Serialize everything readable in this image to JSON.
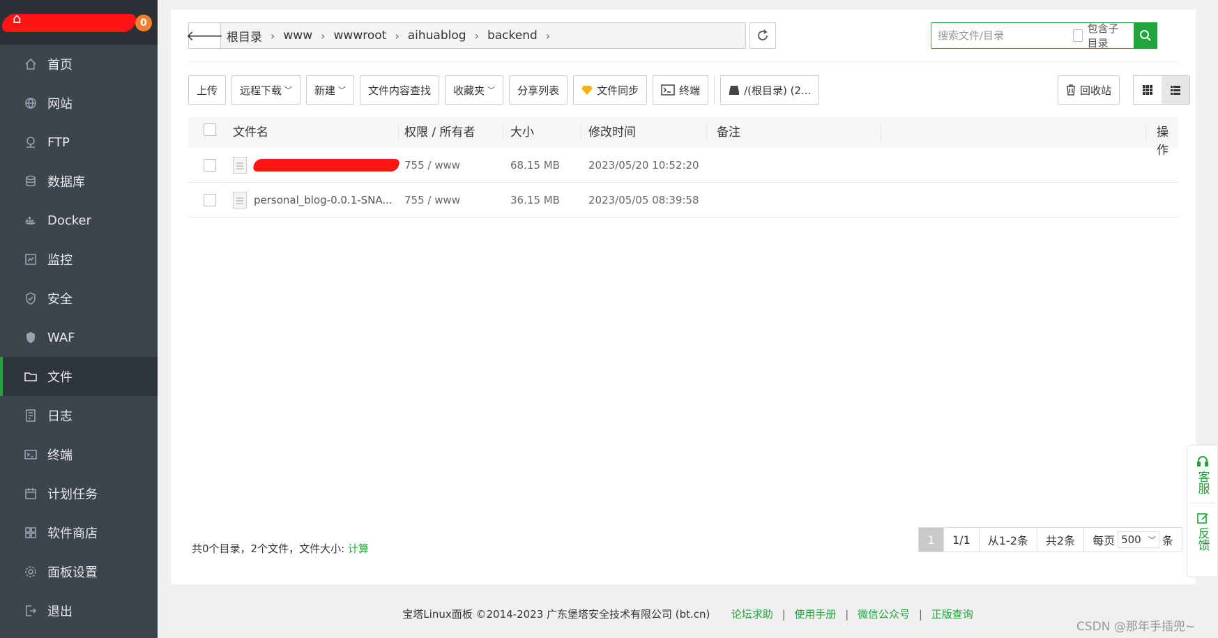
{
  "sidebar": {
    "badge": "0",
    "items": [
      {
        "label": "首页",
        "icon": "home-icon"
      },
      {
        "label": "网站",
        "icon": "globe-icon"
      },
      {
        "label": "FTP",
        "icon": "ftp-icon"
      },
      {
        "label": "数据库",
        "icon": "database-icon"
      },
      {
        "label": "Docker",
        "icon": "docker-icon"
      },
      {
        "label": "监控",
        "icon": "monitor-icon"
      },
      {
        "label": "安全",
        "icon": "shield-icon"
      },
      {
        "label": "WAF",
        "icon": "waf-icon"
      },
      {
        "label": "文件",
        "icon": "folder-icon",
        "active": true
      },
      {
        "label": "日志",
        "icon": "log-icon"
      },
      {
        "label": "终端",
        "icon": "terminal-icon"
      },
      {
        "label": "计划任务",
        "icon": "calendar-icon"
      },
      {
        "label": "软件商店",
        "icon": "apps-icon"
      },
      {
        "label": "面板设置",
        "icon": "gear-icon"
      },
      {
        "label": "退出",
        "icon": "logout-icon"
      }
    ]
  },
  "path": {
    "crumbs": [
      "根目录",
      "www",
      "wwwroot",
      "aihuablog",
      "backend"
    ]
  },
  "search": {
    "placeholder": "搜索文件/目录",
    "include_sub_label": "包含子目录"
  },
  "toolbar": {
    "upload": "上传",
    "remote_download": "远程下载",
    "new": "新建",
    "content_search": "文件内容查找",
    "favorites": "收藏夹",
    "share_list": "分享列表",
    "file_sync": "文件同步",
    "terminal": "终端",
    "disk": "/(根目录) (2...",
    "recycle": "回收站"
  },
  "table": {
    "headers": {
      "name": "文件名",
      "perm": "权限 / 所有者",
      "size": "大小",
      "mtime": "修改时间",
      "note": "备注",
      "op": "操作"
    },
    "rows": [
      {
        "name": "",
        "redacted": true,
        "perm": "755 / www",
        "size": "68.15 MB",
        "mtime": "2023/05/20 10:52:20",
        "note": ""
      },
      {
        "name": "personal_blog-0.0.1-SNA...",
        "redacted": false,
        "perm": "755 / www",
        "size": "36.15 MB",
        "mtime": "2023/05/05 08:39:58",
        "note": ""
      }
    ]
  },
  "summary": {
    "text": "共0个目录，2个文件，文件大小:",
    "calc": "计算"
  },
  "pager": {
    "current": "1",
    "pages": "1/1",
    "range": "从1-2条",
    "total": "共2条",
    "per_page_label": "每页",
    "per_page": "500",
    "unit": "条"
  },
  "footer": {
    "copyright": "宝塔Linux面板 ©2014-2023 广东堡塔安全技术有限公司 (bt.cn)",
    "links": [
      "论坛求助",
      "使用手册",
      "微信公众号",
      "正版查询"
    ]
  },
  "float": {
    "service": "客服",
    "feedback": "反馈"
  },
  "watermark": "CSDN @那年手插兜~",
  "colors": {
    "accent": "#20a53a",
    "sidebar_bg": "#3c444d",
    "badge": "#f0802d"
  }
}
